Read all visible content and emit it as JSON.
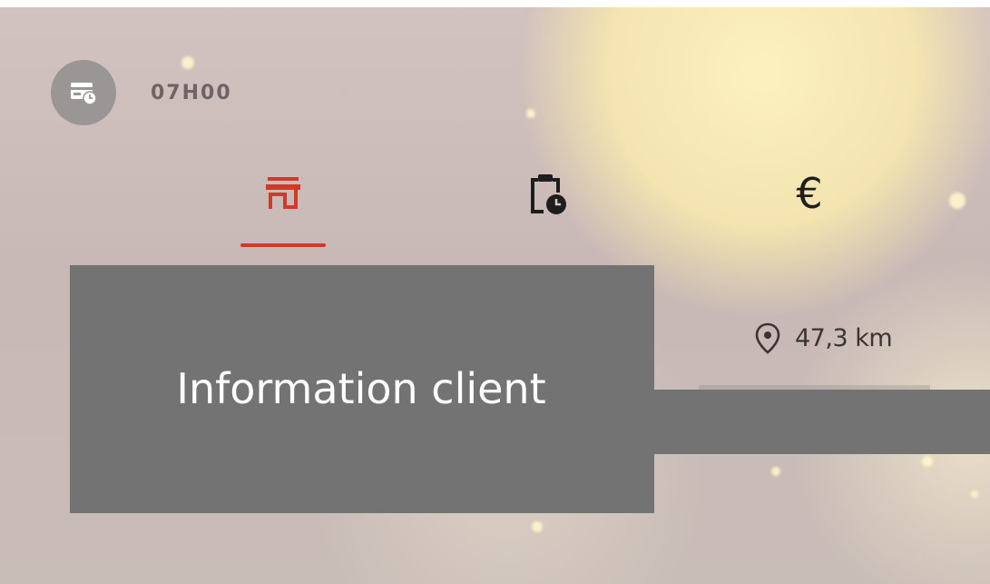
{
  "header": {
    "avatar_icon": "card-clock-icon",
    "time": "07H00"
  },
  "tabs": [
    {
      "id": "shop",
      "icon": "storefront-icon",
      "active": true
    },
    {
      "id": "schedule",
      "icon": "clipboard-clock-icon",
      "active": false
    },
    {
      "id": "price",
      "icon": "euro-icon",
      "symbol": "€",
      "active": false
    }
  ],
  "distance": {
    "icon": "location-pin-icon",
    "value": "47,3 km"
  },
  "tooltip": {
    "text": "Information client"
  },
  "colors": {
    "accent": "#d13a28",
    "overlay": "#737373",
    "avatar": "#9a9696",
    "text_dark": "#1e1e1e"
  }
}
